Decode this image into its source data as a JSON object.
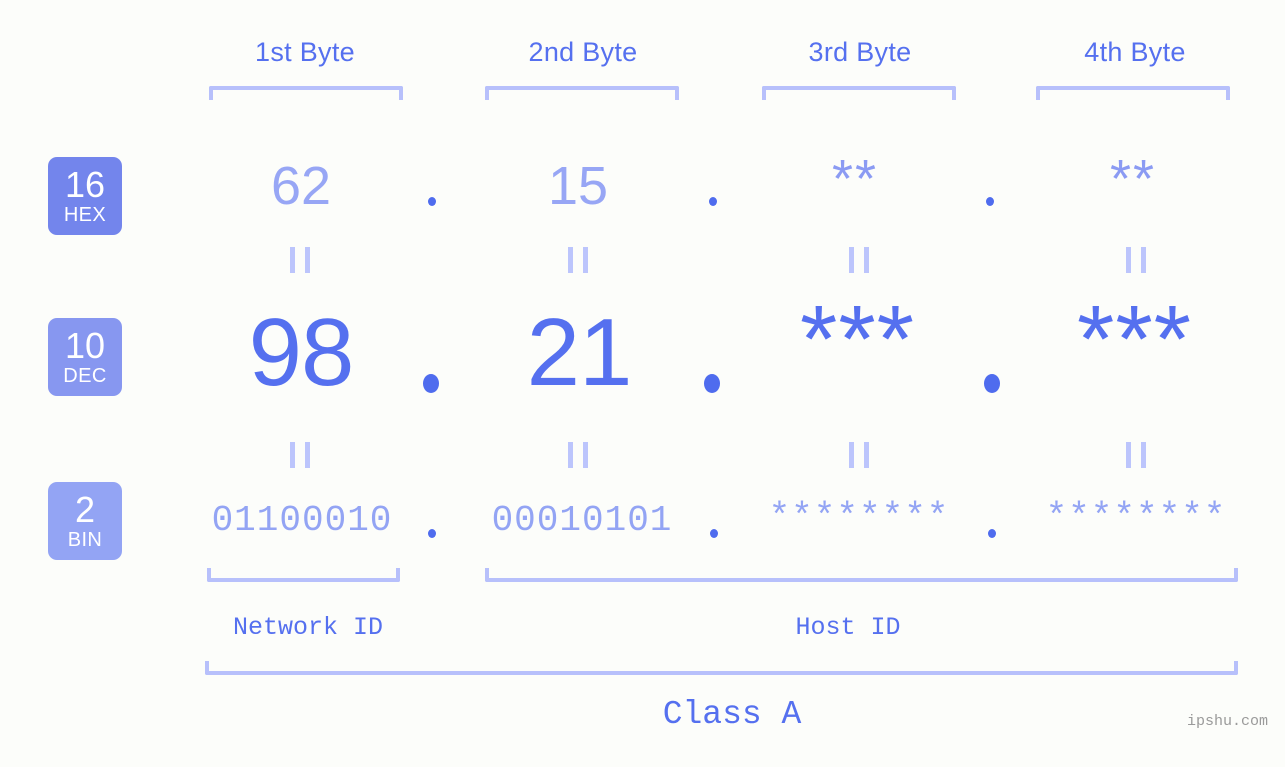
{
  "background_color": "#fcfdfa",
  "accent_color": "#5570ef",
  "accent_light_color": "#b7c0fb",
  "byte_headers": [
    {
      "label": "1st Byte"
    },
    {
      "label": "2nd Byte"
    },
    {
      "label": "3rd Byte"
    },
    {
      "label": "4th Byte"
    }
  ],
  "rows": [
    {
      "base_number": "16",
      "base_name": "HEX",
      "badge_color": "#7385ec",
      "values": [
        "62",
        "15",
        "**",
        "**"
      ],
      "separator": "."
    },
    {
      "base_number": "10",
      "base_name": "DEC",
      "badge_color": "#8797f0",
      "values": [
        "98",
        "21",
        "***",
        "***"
      ],
      "separator": "."
    },
    {
      "base_number": "2",
      "base_name": "BIN",
      "badge_color": "#93a4f4",
      "values": [
        "01100010",
        "00010101",
        "********",
        "********"
      ],
      "separator": "."
    }
  ],
  "equality_marker": "||",
  "segments": {
    "network_id": "Network ID",
    "host_id": "Host ID"
  },
  "class_label": "Class A",
  "watermark": "ipshu.com"
}
